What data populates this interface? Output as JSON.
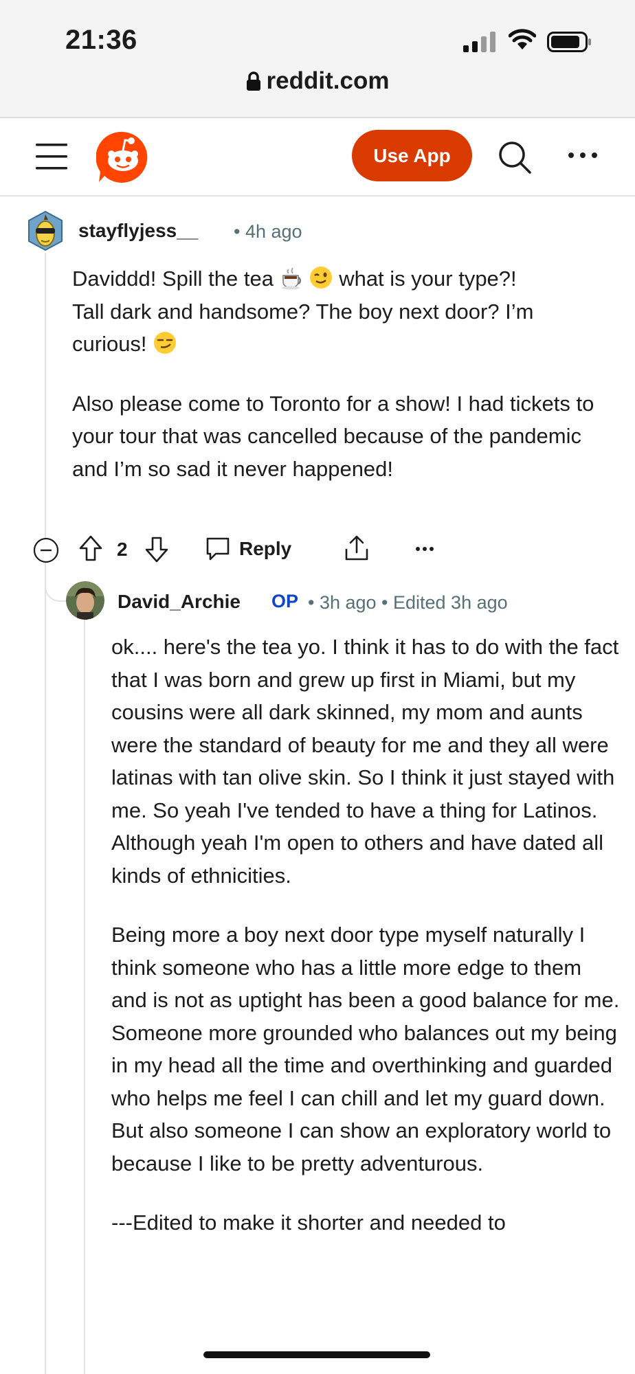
{
  "status_bar": {
    "time": "21:36"
  },
  "browser": {
    "url": "reddit.com"
  },
  "header": {
    "use_app_label": "Use App",
    "brand_color": "#d93a00"
  },
  "comments": [
    {
      "username": "stayflyjess__",
      "time": "• 4h ago",
      "paragraphs": [
        {
          "line1_a": "Daviddd! Spill the tea ",
          "line1_b": " what is your type?!",
          "line2": "Tall dark and handsome? The boy next door? I’m",
          "line3": "curious! "
        },
        {
          "text": "Also please come to Toronto for a show! I had tickets to your tour that was cancelled because of the pandemic and I’m so sad it never happened!"
        }
      ],
      "score": "2",
      "reply_label": "Reply"
    },
    {
      "username": "David_Archie",
      "op_badge": "OP",
      "time_meta": "• 3h ago • Edited 3h ago",
      "paragraphs": [
        "ok.... here's the tea yo. I think it has to do with the fact that I was born and grew up first in Miami, but my cousins were all dark skinned, my mom and aunts were the standard of beauty for me and they all were latinas with tan olive skin. So I think it just stayed with me. So yeah I've tended to have a thing for Latinos. Although yeah I'm open to others and have dated all kinds of ethnicities.",
        "Being more a boy next door type myself naturally I think someone who has a little more edge to them and is not as uptight has been a good balance for me. Someone more grounded who balances out my being in my head all the time and overthinking and guarded who helps me feel I can chill and let my guard down. But also someone I can show an exploratory world to because I like to be pretty adventurous.",
        "---Edited to make it shorter and needed to"
      ]
    }
  ]
}
